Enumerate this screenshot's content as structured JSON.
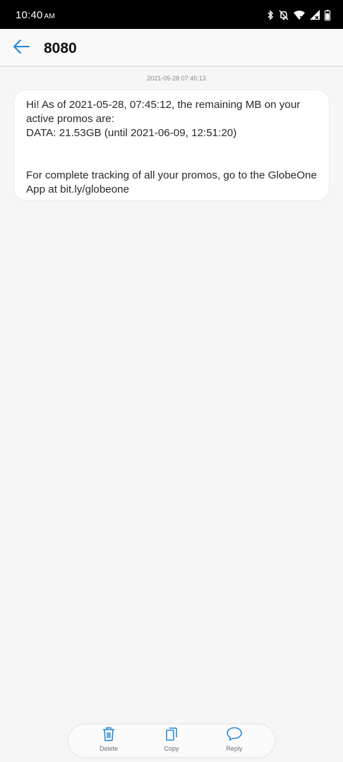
{
  "status_bar": {
    "time": "10:40",
    "ampm": "AM",
    "icons": [
      "bluetooth-icon",
      "notifications-off-icon",
      "wifi-icon",
      "signal-icon",
      "battery-icon"
    ]
  },
  "app_bar": {
    "title": "8080",
    "back_icon": "back-arrow-icon"
  },
  "conversation": {
    "timestamp": "2021-05-28 07:45:13",
    "message": {
      "line1": "Hi! As of 2021-05-28, 07:45:12, the remaining MB on your active promos are:",
      "line2": "DATA: 21.53GB (until 2021-06-09, 12:51:20)",
      "line3": "For complete tracking of all your promos, go to the GlobeOne App at bit.ly/globeone"
    }
  },
  "actions": {
    "delete_label": "Delete",
    "copy_label": "Copy",
    "reply_label": "Reply"
  },
  "colors": {
    "accent": "#1f86d8",
    "status_bar": "#000000",
    "background": "#f6f6f7"
  }
}
